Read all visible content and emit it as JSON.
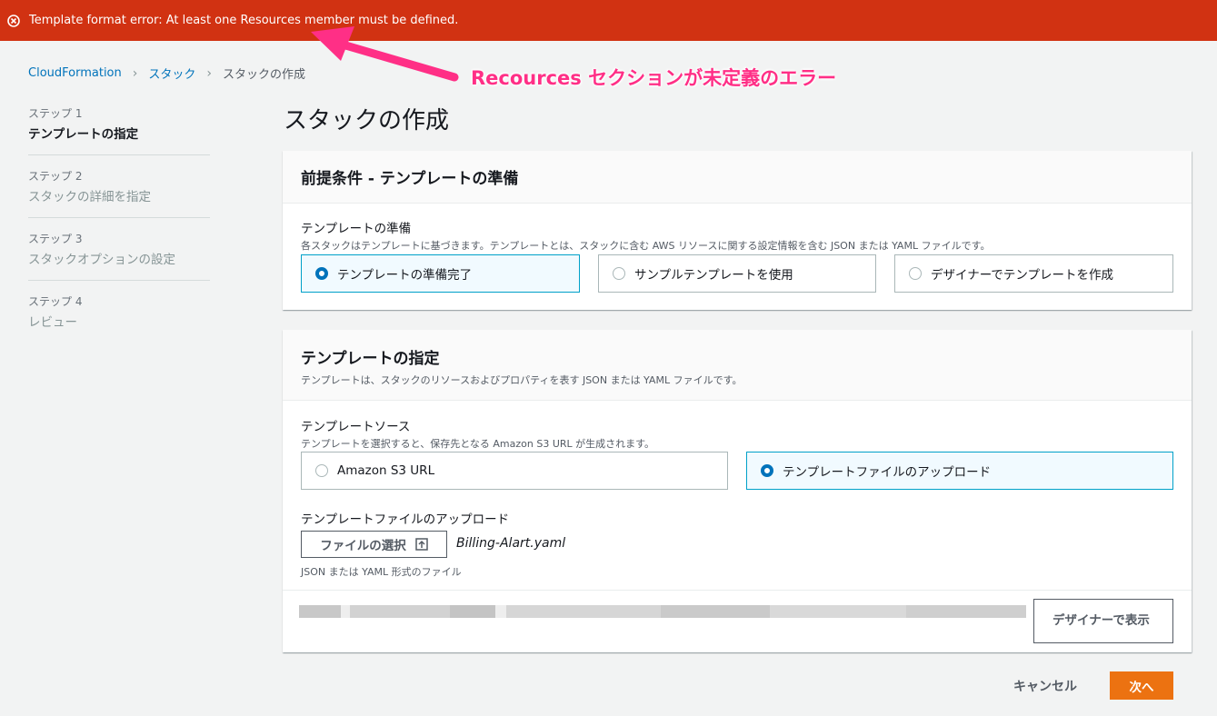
{
  "error": {
    "message": "Template format error: At least one Resources member must be defined.",
    "color": "#d13212"
  },
  "annotation": {
    "text": "Recources セクションが未定義のエラー",
    "color": "#ff2f86"
  },
  "breadcrumb": {
    "items": [
      "CloudFormation",
      "スタック",
      "スタックの作成"
    ]
  },
  "steps": [
    {
      "num": "ステップ 1",
      "title": "テンプレートの指定",
      "active": true
    },
    {
      "num": "ステップ 2",
      "title": "スタックの詳細を指定",
      "active": false
    },
    {
      "num": "ステップ 3",
      "title": "スタックオプションの設定",
      "active": false
    },
    {
      "num": "ステップ 4",
      "title": "レビュー",
      "active": false
    }
  ],
  "page_title": "スタックの作成",
  "prereq_panel": {
    "title": "前提条件 - テンプレートの準備",
    "field_label": "テンプレートの準備",
    "field_desc": "各スタックはテンプレートに基づきます。テンプレートとは、スタックに含む AWS リソースに関する設定情報を含む JSON または YAML ファイルです。",
    "options": [
      "テンプレートの準備完了",
      "サンプルテンプレートを使用",
      "デザイナーでテンプレートを作成"
    ],
    "selected_index": 0
  },
  "template_panel": {
    "title": "テンプレートの指定",
    "desc": "テンプレートは、スタックのリソースおよびプロパティを表す JSON または YAML ファイルです。",
    "source_label": "テンプレートソース",
    "source_desc": "テンプレートを選択すると、保存先となる Amazon S3 URL が生成されます。",
    "source_options": [
      "Amazon S3 URL",
      "テンプレートファイルのアップロード"
    ],
    "selected_index": 1,
    "upload_label": "テンプレートファイルのアップロード",
    "choose_file_button": "ファイルの選択",
    "file_name": "Billing-Alart.yaml",
    "file_hint": "JSON または YAML 形式のファイル",
    "designer_button": "デザイナーで表示"
  },
  "footer": {
    "cancel": "キャンセル",
    "next": "次へ",
    "next_color": "#ec7211"
  }
}
